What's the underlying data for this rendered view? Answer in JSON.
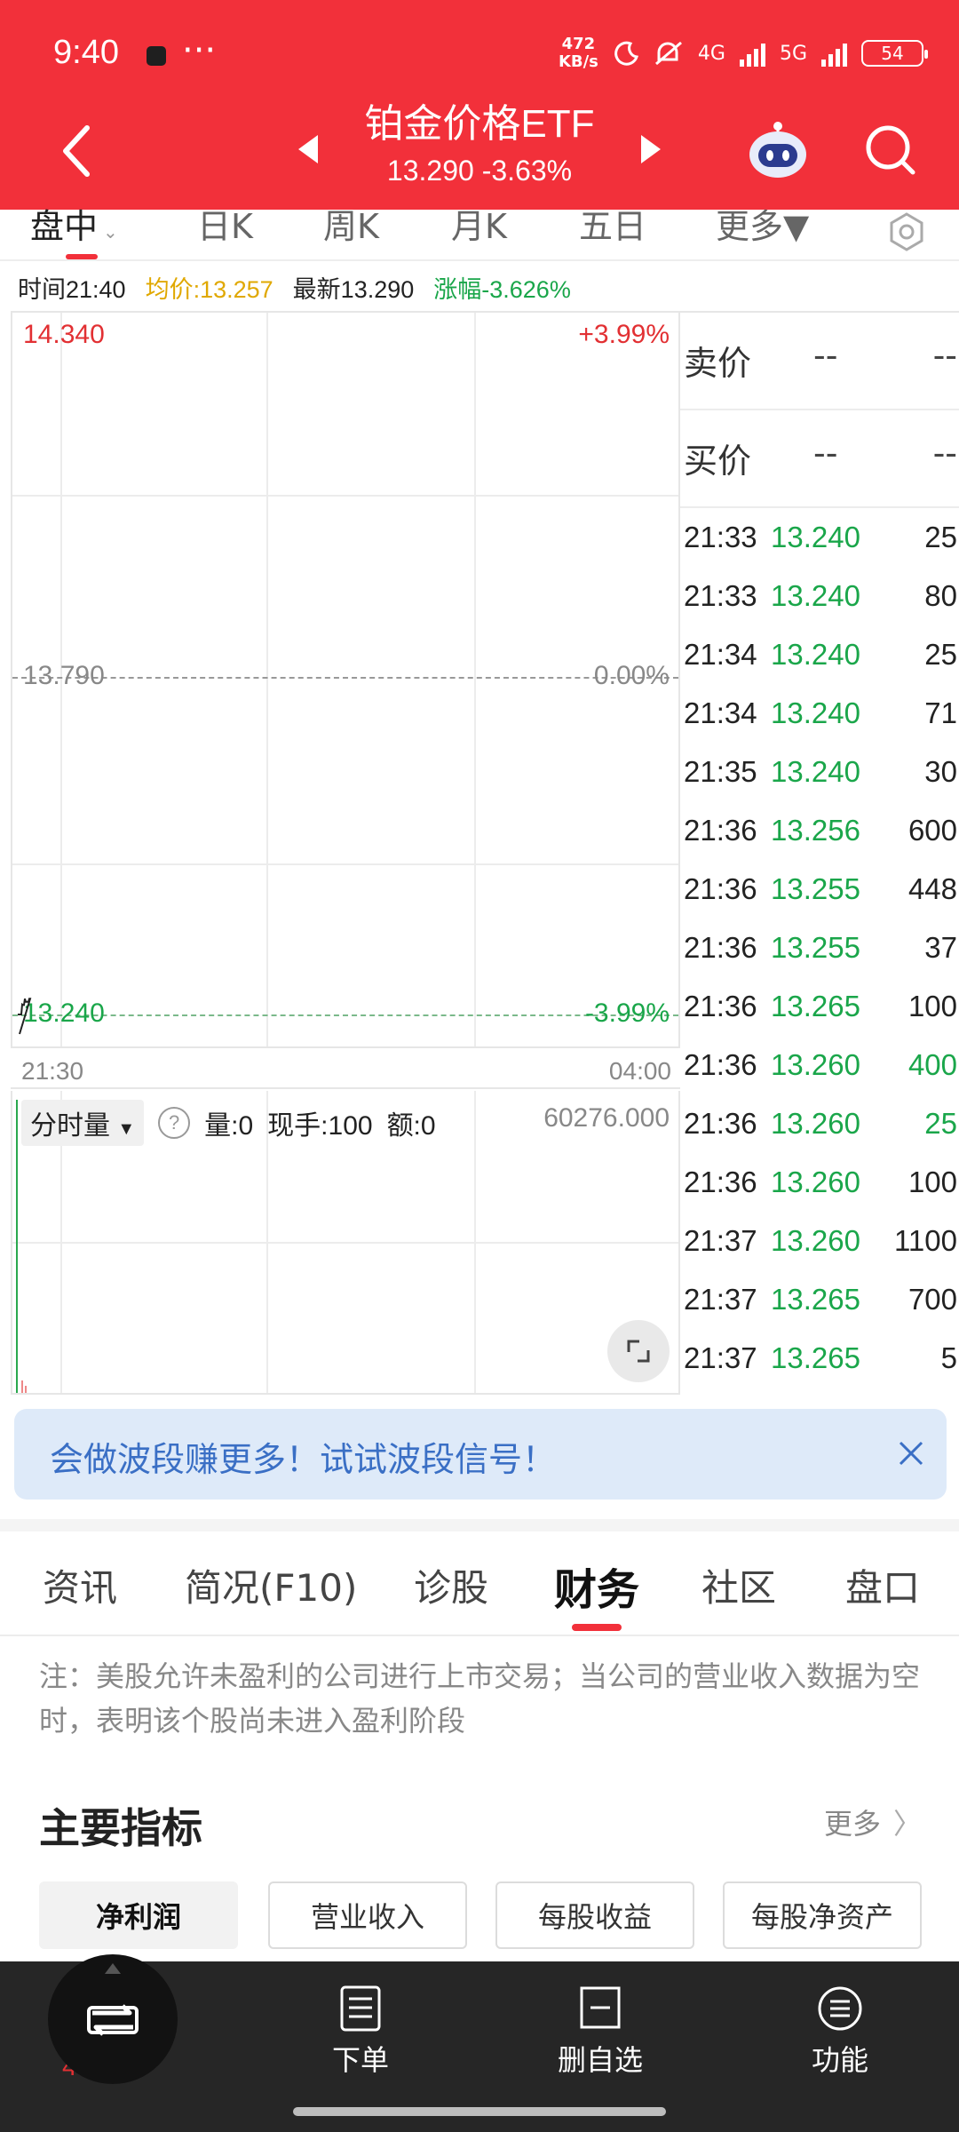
{
  "status_bar": {
    "time": "9:40",
    "more": "···",
    "net_speed_value": "472",
    "net_speed_unit": "KB/s",
    "net_4g": "4G",
    "net_5g": "5G",
    "battery": "54"
  },
  "header": {
    "title": "铂金价格ETF",
    "subtitle": "13.290 -3.63%",
    "colors": {
      "background": "#f2303a"
    }
  },
  "chart_tabs": [
    {
      "label": "盘中"
    },
    {
      "label": "日K"
    },
    {
      "label": "周K"
    },
    {
      "label": "月K"
    },
    {
      "label": "五日"
    },
    {
      "label": "更多▼"
    }
  ],
  "info_line": {
    "time": "时间21:40",
    "avg": "均价:13.257",
    "latest": "最新13.290",
    "change": "涨幅-3.626%"
  },
  "chart_data": {
    "type": "line",
    "title": "",
    "xlabel": "",
    "ylabel": "",
    "x_ticks": [
      "21:30",
      "04:00"
    ],
    "ylim": [
      13.24,
      14.34
    ],
    "y_ticks_left": [
      "14.340",
      "13.790",
      "13.240"
    ],
    "y_ticks_right": [
      "+3.99%",
      "0.00%",
      "-3.99%"
    ],
    "grid": true,
    "series": [
      {
        "values": [
          13.24,
          13.24,
          13.24,
          13.24,
          13.24,
          13.256,
          13.255,
          13.255,
          13.265,
          13.26,
          13.26,
          13.26,
          13.26,
          13.265,
          13.265
        ]
      }
    ]
  },
  "volume_panel": {
    "select_label": "分时量",
    "help": "?",
    "vol": "量:0",
    "now_hand": "现手:100",
    "amount": "额:0",
    "max": "60276.000"
  },
  "quotes": {
    "sell": {
      "label": "卖价",
      "v1": "--",
      "v2": "--"
    },
    "buy": {
      "label": "买价",
      "v1": "--",
      "v2": "--"
    }
  },
  "trades": [
    {
      "time": "21:33",
      "price": "13.240",
      "qty": "25",
      "qty_green": false
    },
    {
      "time": "21:33",
      "price": "13.240",
      "qty": "80",
      "qty_green": false
    },
    {
      "time": "21:34",
      "price": "13.240",
      "qty": "25",
      "qty_green": false
    },
    {
      "time": "21:34",
      "price": "13.240",
      "qty": "71",
      "qty_green": false
    },
    {
      "time": "21:35",
      "price": "13.240",
      "qty": "30",
      "qty_green": false
    },
    {
      "time": "21:36",
      "price": "13.256",
      "qty": "600",
      "qty_green": false
    },
    {
      "time": "21:36",
      "price": "13.255",
      "qty": "448",
      "qty_green": false
    },
    {
      "time": "21:36",
      "price": "13.255",
      "qty": "37",
      "qty_green": false
    },
    {
      "time": "21:36",
      "price": "13.265",
      "qty": "100",
      "qty_green": false
    },
    {
      "time": "21:36",
      "price": "13.260",
      "qty": "400",
      "qty_green": true
    },
    {
      "time": "21:36",
      "price": "13.260",
      "qty": "25",
      "qty_green": true
    },
    {
      "time": "21:36",
      "price": "13.260",
      "qty": "100",
      "qty_green": false
    },
    {
      "time": "21:37",
      "price": "13.260",
      "qty": "1100",
      "qty_green": false
    },
    {
      "time": "21:37",
      "price": "13.265",
      "qty": "700",
      "qty_green": false
    },
    {
      "time": "21:37",
      "price": "13.265",
      "qty": "5",
      "qty_green": false
    }
  ],
  "promo": {
    "text": "会做波段赚更多！试试波段信号！"
  },
  "section_tabs": [
    {
      "label": "资讯"
    },
    {
      "label": "简况(F10)"
    },
    {
      "label": "诊股"
    },
    {
      "label": "财务"
    },
    {
      "label": "社区"
    },
    {
      "label": "盘口"
    }
  ],
  "note": "注：美股允许未盈利的公司进行上市交易；当公司的营业收入数据为空时，表明该个股尚未进入盈利阶段",
  "main_indicators": {
    "title": "主要指标",
    "more": "更多",
    "buttons": [
      {
        "label": "净利润"
      },
      {
        "label": "营业收入"
      },
      {
        "label": "每股收益"
      },
      {
        "label": "每股净资产"
      }
    ]
  },
  "bottom_bar": {
    "fab_under": "4 71",
    "items": [
      {
        "label": "下单"
      },
      {
        "label": "删自选"
      },
      {
        "label": "功能"
      }
    ]
  }
}
